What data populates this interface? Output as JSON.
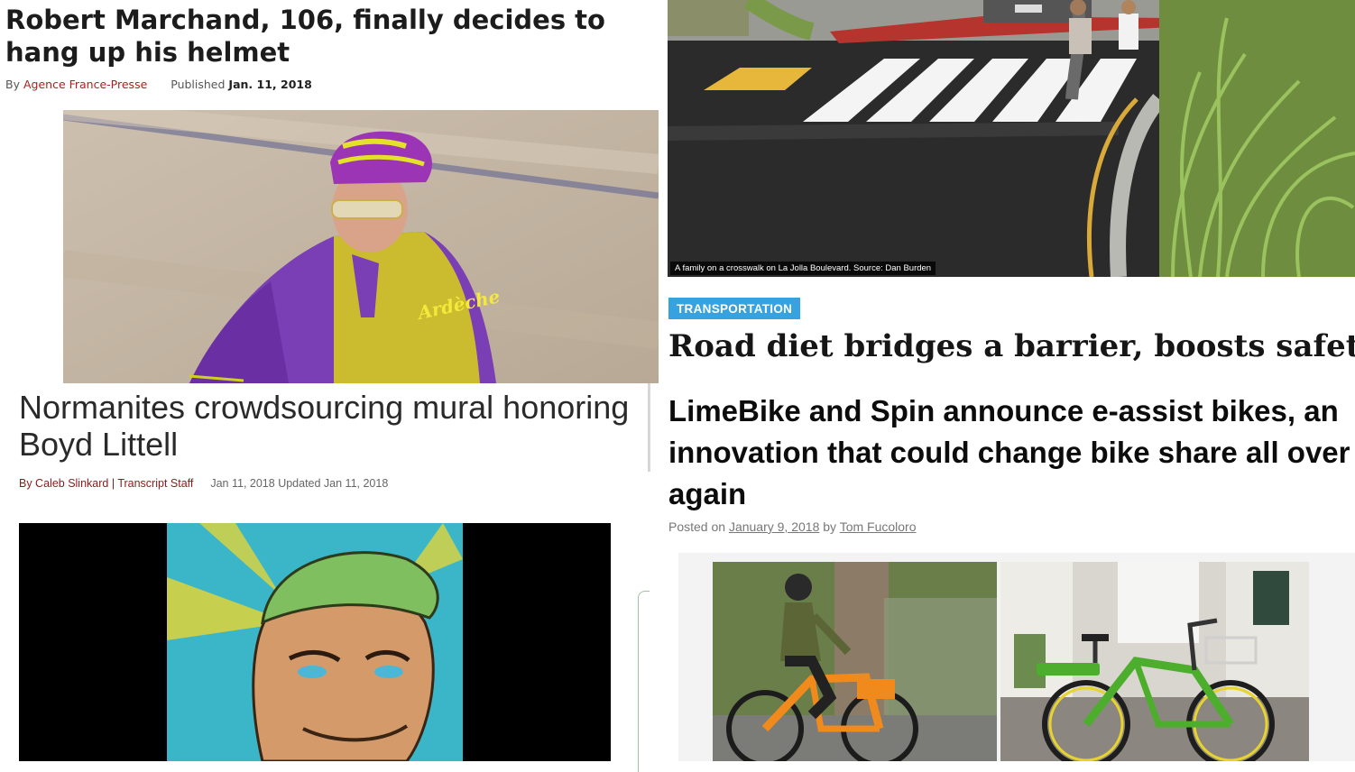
{
  "articles": {
    "marchand": {
      "headline": "Robert Marchand, 106, finally decides to hang up his helmet",
      "by_label": "By",
      "author": "Agence France-Presse",
      "published_label": "Published",
      "date": "Jan. 11, 2018",
      "photo_jersey_text": "Ardèche"
    },
    "mural": {
      "headline": "Normanites crowdsourcing mural honoring Boyd Littell",
      "author": "By Caleb Slinkard | Transcript Staff",
      "date": "Jan 11, 2018 Updated Jan 11, 2018"
    },
    "road_diet": {
      "caption": "A family on a crosswalk on La Jolla Boulevard. Source: Dan Burden",
      "tag": "TRANSPORTATION",
      "headline": "Road diet bridges a barrier, boosts safety"
    },
    "limebike": {
      "headline": "LimeBike and Spin announce e-assist bikes, an innovation that could change bike share all over again",
      "posted_label": "Posted on",
      "date": "January 9, 2018",
      "by_label": "by",
      "author": "Tom Fucoloro"
    }
  },
  "colors": {
    "marchand_author": "#b01e1e",
    "mural_author": "#8b1a1a",
    "tag_background": "#36a3e0",
    "lime_green": "#4cae2c",
    "spin_orange": "#f08a1c"
  }
}
